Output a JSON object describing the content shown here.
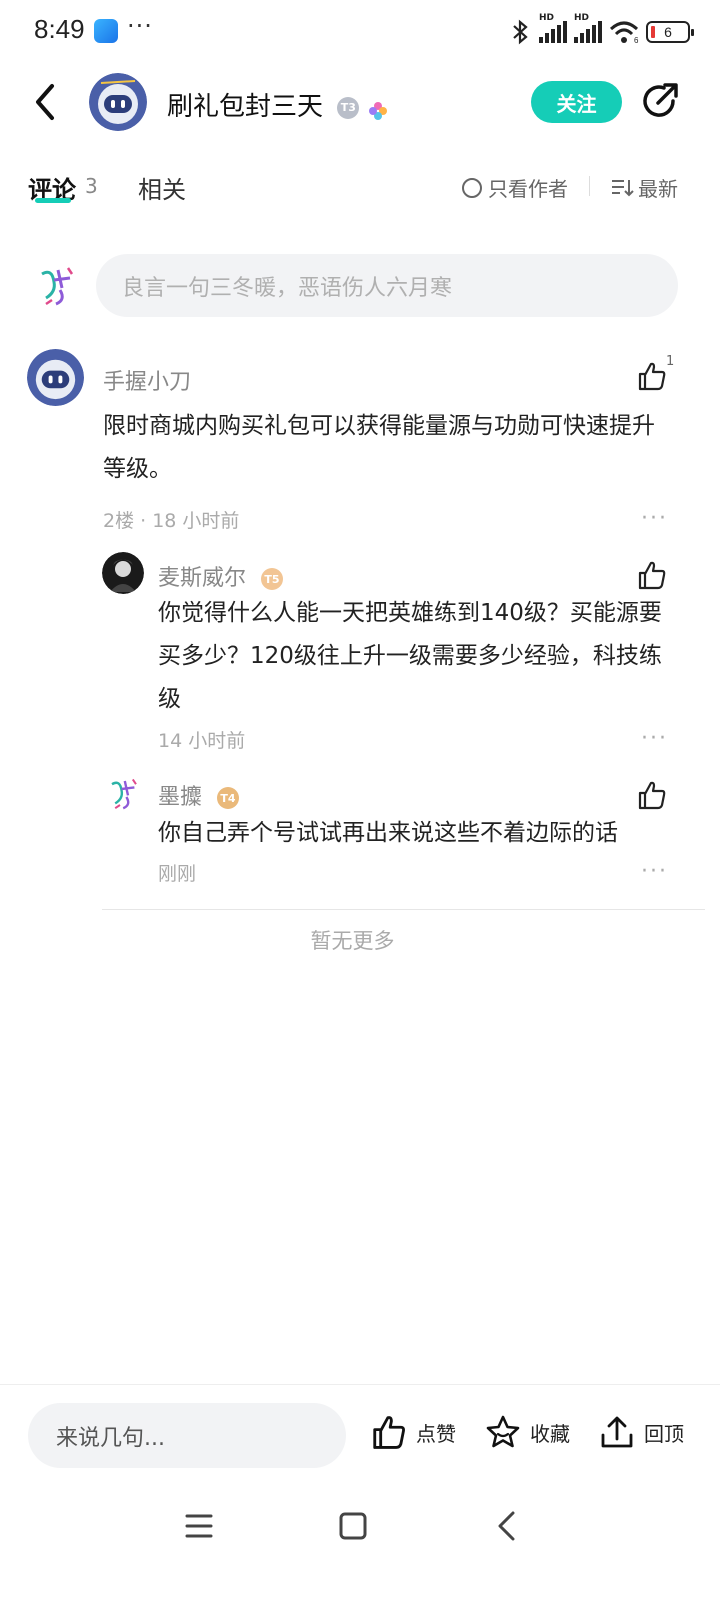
{
  "status_bar": {
    "time": "8:49",
    "dots": "···",
    "signal_label": "HD",
    "signal_sub": "6",
    "battery": "6"
  },
  "header": {
    "title": "刷礼包封三天",
    "badge": "T3",
    "follow_label": "关注",
    "icons": [
      "back-arrow-icon",
      "share-icon"
    ]
  },
  "tabs": {
    "comments_label": "评论",
    "comments_count": "3",
    "related_label": "相关",
    "author_only_label": "只看作者",
    "sort_label": "最新"
  },
  "comment_box": {
    "placeholder": "良言一句三冬暖，恶语伤人六月寒"
  },
  "comment": {
    "author": "手握小刀",
    "text": "限时商城内购买礼包可以获得能量源与功勋可快速提升等级。",
    "meta": "2楼 · 18 小时前",
    "likes": "1"
  },
  "replies": [
    {
      "author": "麦斯威尔",
      "badge": "T5",
      "text": "你觉得什么人能一天把英雄练到140级？买能源要买多少？120级往上升一级需要多少经验，科技练级",
      "meta": "14 小时前"
    },
    {
      "author": "墨攗",
      "badge": "T4",
      "text": "你自己弄个号试试再出来说这些不着边际的话",
      "meta": "刚刚"
    }
  ],
  "more_label": "···",
  "no_more": "暂无更多",
  "bottom_bar": {
    "input_placeholder": "来说几句...",
    "like_label": "点赞",
    "favorite_label": "收藏",
    "top_label": "回顶"
  },
  "colors": {
    "accent": "#15cdb7",
    "text": "#222222",
    "muted": "#888888",
    "input_bg": "#f2f3f5"
  }
}
